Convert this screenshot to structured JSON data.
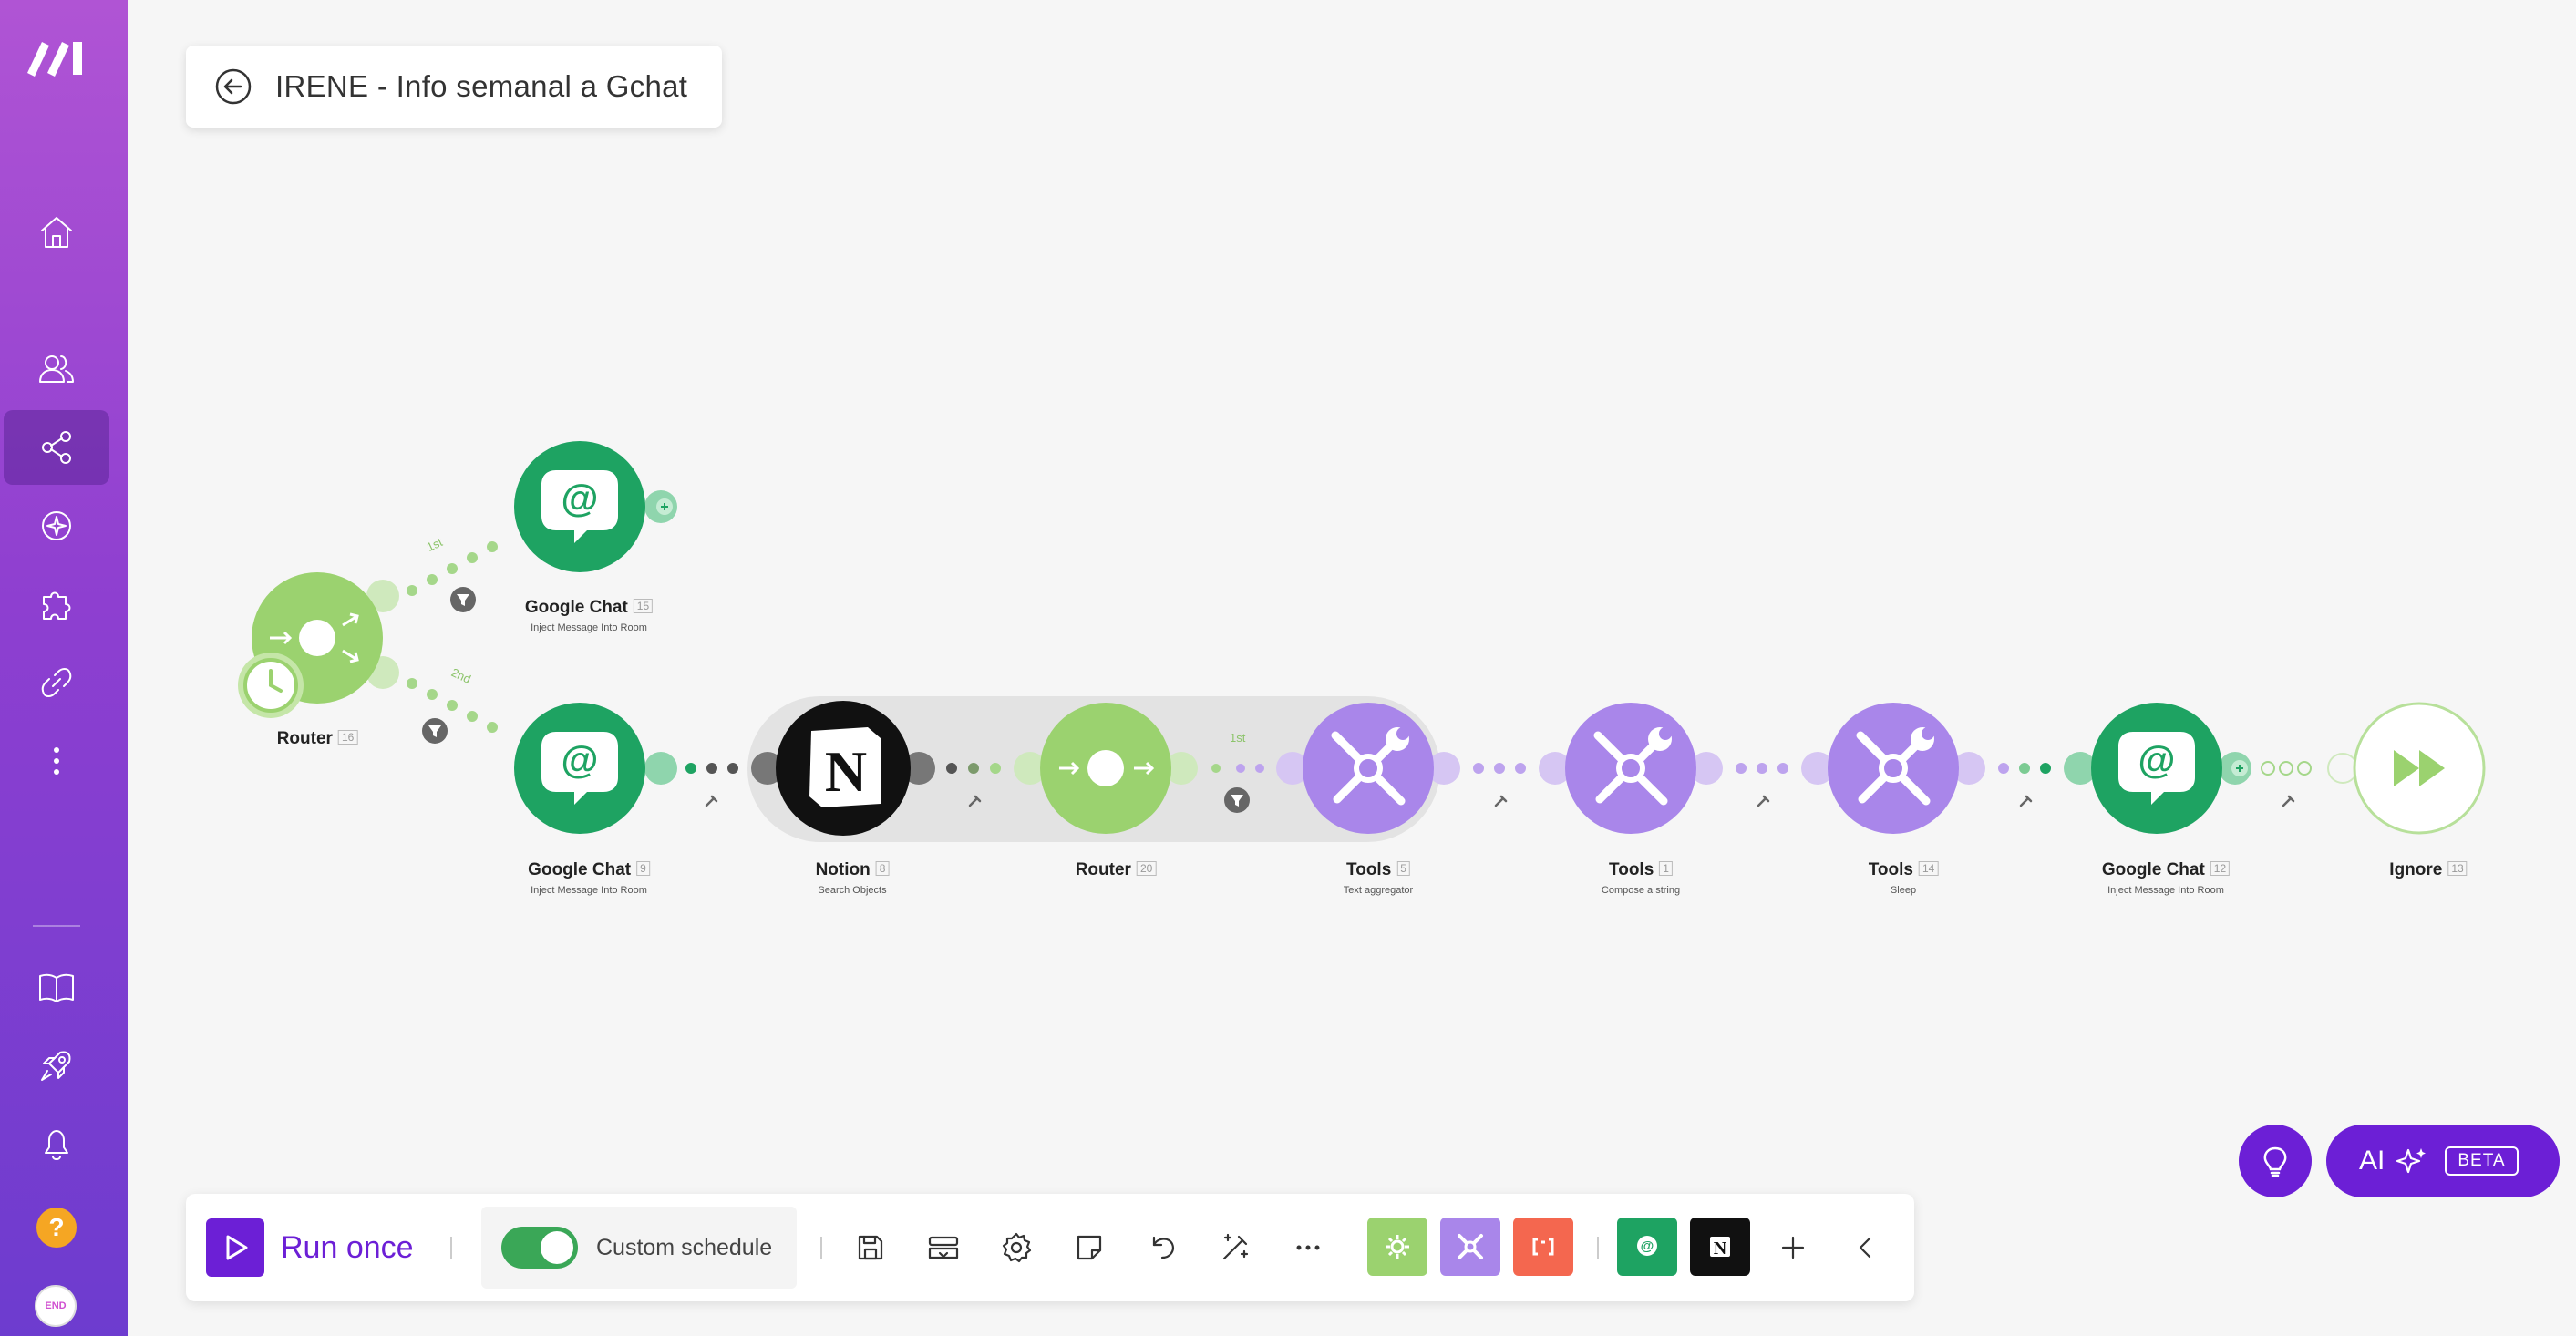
{
  "scenario": {
    "title": "IRENE - Info semanal a Gchat"
  },
  "sidebar": {
    "items": [
      {
        "name": "home",
        "icon": "home-icon"
      },
      {
        "name": "team",
        "icon": "users-icon"
      },
      {
        "name": "scenarios",
        "icon": "share-icon",
        "active": true
      },
      {
        "name": "ai",
        "icon": "brain-icon"
      },
      {
        "name": "apps",
        "icon": "puzzle-icon"
      },
      {
        "name": "connections",
        "icon": "link-icon"
      },
      {
        "name": "more",
        "icon": "dots-vertical-icon"
      },
      {
        "name": "docs",
        "icon": "book-icon"
      },
      {
        "name": "launch",
        "icon": "rocket-icon"
      },
      {
        "name": "notifications",
        "icon": "bell-icon"
      },
      {
        "name": "help",
        "icon": "question-icon"
      },
      {
        "name": "profile",
        "icon": "avatar-icon"
      }
    ],
    "avatar_text": "END"
  },
  "nodes": {
    "router_start": {
      "name": "Router",
      "id": "16",
      "sub": ""
    },
    "gchat_top": {
      "name": "Google Chat",
      "id": "15",
      "sub": "Inject Message Into Room"
    },
    "gchat_9": {
      "name": "Google Chat",
      "id": "9",
      "sub": "Inject Message Into Room"
    },
    "notion": {
      "name": "Notion",
      "id": "8",
      "sub": "Search Objects"
    },
    "router_20": {
      "name": "Router",
      "id": "20",
      "sub": ""
    },
    "tools_5": {
      "name": "Tools",
      "id": "5",
      "sub": "Text aggregator"
    },
    "tools_1": {
      "name": "Tools",
      "id": "1",
      "sub": "Compose a string"
    },
    "tools_14": {
      "name": "Tools",
      "id": "14",
      "sub": "Sleep"
    },
    "gchat_12": {
      "name": "Google Chat",
      "id": "12",
      "sub": "Inject Message Into Room"
    },
    "ignore": {
      "name": "Ignore",
      "id": "13",
      "sub": ""
    }
  },
  "routes": {
    "first": "1st",
    "second": "2nd",
    "router20_first": "1st"
  },
  "toolbar": {
    "run_once": "Run once",
    "schedule_label": "Custom schedule",
    "schedule_enabled": true,
    "icons": [
      "save-icon",
      "explain-flow-icon",
      "settings-icon",
      "notes-icon",
      "undo-icon",
      "auto-align-icon",
      "more-icon"
    ],
    "app_chips": [
      "flow-control-chip",
      "tools-chip",
      "text-parser-chip",
      "google-chat-chip",
      "notion-chip"
    ]
  },
  "ai": {
    "label": "AI",
    "badge": "BETA"
  },
  "colors": {
    "sidebar_top": "#b054d4",
    "sidebar_bottom": "#6d3ccf",
    "router_green": "#9bd26f",
    "gchat_green": "#1ea362",
    "tools_purple": "#a986ea",
    "notion_black": "#111111",
    "accent_purple": "#6c1fd6"
  }
}
